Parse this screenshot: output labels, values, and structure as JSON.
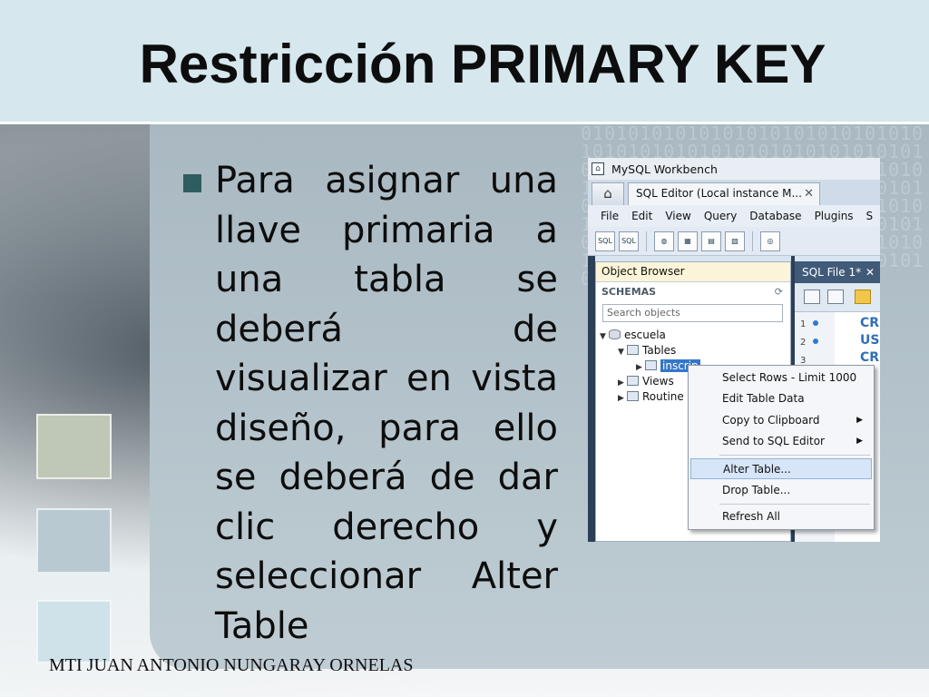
{
  "slide": {
    "title": "Restricción PRIMARY KEY",
    "bullet": "Para asignar una llave primaria a una tabla se deberá de visualizar en vista diseño, para ello se deberá de dar clic derecho y seleccionar Alter Table",
    "footer": "MTI JUAN ANTONIO NUNGARAY ORNELAS",
    "binary": "0101010101010101010101010101010101010101010101010101010101010101010101010101010101010101010101010101010101010101010101010101010101010101010101010101010101010101010101010101010101010101010101010101010101010101010101010101010101010101010101"
  },
  "workbench": {
    "window_title": "MySQL Workbench",
    "home_icon": "home-icon",
    "editor_tab": "SQL Editor (Local instance M...",
    "editor_tab_close": "✕",
    "menu": [
      "File",
      "Edit",
      "View",
      "Query",
      "Database",
      "Plugins",
      "S"
    ],
    "object_browser": {
      "header": "Object Browser",
      "schemas_label": "SCHEMAS",
      "refresh_icon": "⟳",
      "search_placeholder": "Search objects",
      "tree": {
        "schema": "escuela",
        "tables": "Tables",
        "selected_table": "inscrip",
        "views": "Views",
        "routines": "Routine"
      }
    },
    "sql_file_tab": "SQL File 1*",
    "sql_file_close": "✕",
    "line_numbers": [
      "1",
      "2",
      "3"
    ],
    "code_keywords": [
      "CR",
      "US",
      "CR"
    ],
    "context_menu": {
      "items": [
        {
          "label": "Select Rows - Limit 1000",
          "submenu": false
        },
        {
          "label": "Edit Table Data",
          "submenu": false
        },
        {
          "label": "Copy to Clipboard",
          "submenu": true
        },
        {
          "label": "Send to SQL Editor",
          "submenu": true
        },
        {
          "label": "Alter Table...",
          "submenu": false,
          "highlighted": true
        },
        {
          "label": "Drop Table...",
          "submenu": false
        },
        {
          "label": "Refresh All",
          "submenu": false
        }
      ],
      "submenu_arrow": "▶"
    }
  },
  "colors": {
    "title_band": "#d6e7ee",
    "bullet_square": "#2f5d5f",
    "selection_blue": "#3577c9",
    "highlight": "#d6e5f7"
  }
}
